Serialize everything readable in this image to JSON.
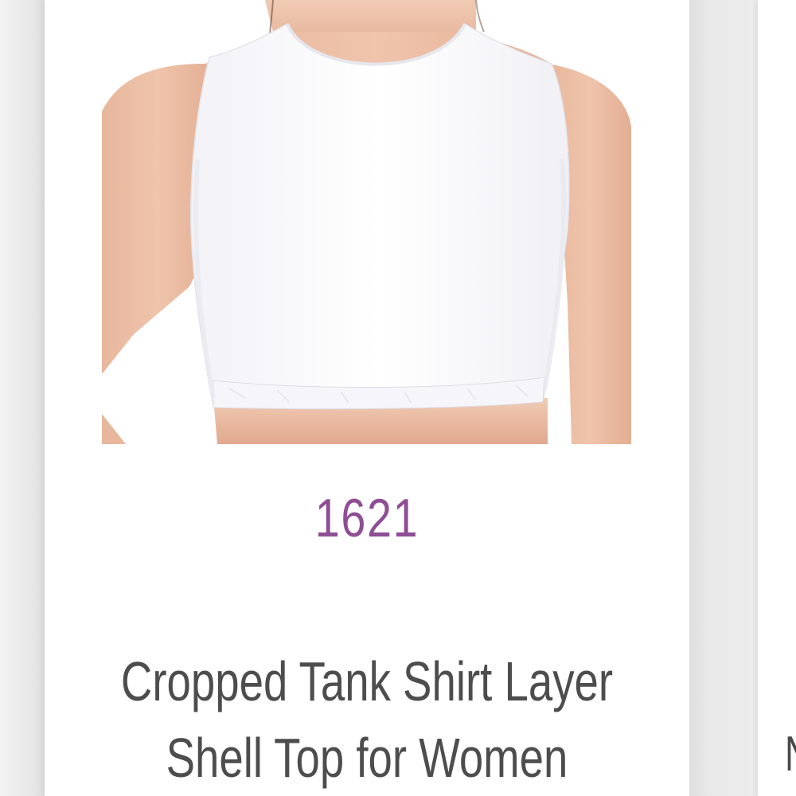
{
  "product": {
    "price": "1621",
    "title_line1": "Cropped Tank Shirt Layer",
    "title_line2": "Shell Top for Women",
    "image_description": "product-photo"
  },
  "next_product": {
    "title_partial": "N"
  },
  "colors": {
    "price": "#8e4e94",
    "title": "#4d4d4d",
    "card_background": "#ffffff",
    "page_background": "#ececec"
  }
}
